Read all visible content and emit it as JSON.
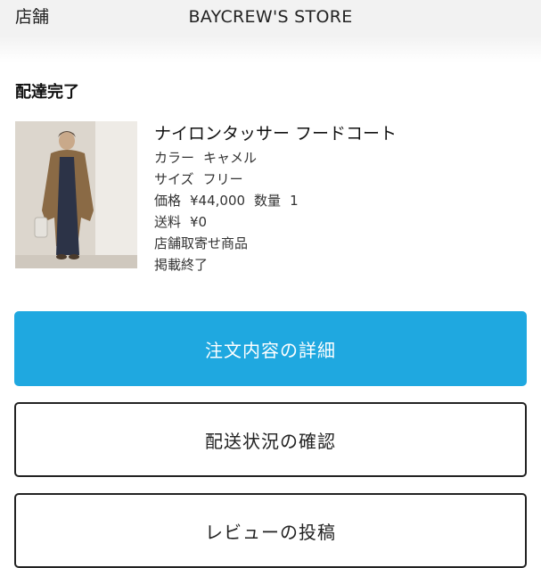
{
  "header": {
    "label": "店舗",
    "store_name": "BAYCREW'S STORE"
  },
  "order": {
    "status": "配達完了"
  },
  "product": {
    "name": "ナイロンタッサー フードコート",
    "color_label": "カラー",
    "color_value": "キャメル",
    "size_label": "サイズ",
    "size_value": "フリー",
    "price_label": "価格",
    "price_value": "¥44,000",
    "quantity_label": "数量",
    "quantity_value": "1",
    "shipping_label": "送料",
    "shipping_value": "¥0",
    "pickup_note": "店舗取寄せ商品",
    "listing_note": "掲載終了"
  },
  "buttons": {
    "order_details": "注文内容の詳細",
    "shipping_status": "配送状況の確認",
    "post_review": "レビューの投稿"
  },
  "colors": {
    "primary_button": "#1fa8e0",
    "header_bg": "#f2f2f2"
  }
}
